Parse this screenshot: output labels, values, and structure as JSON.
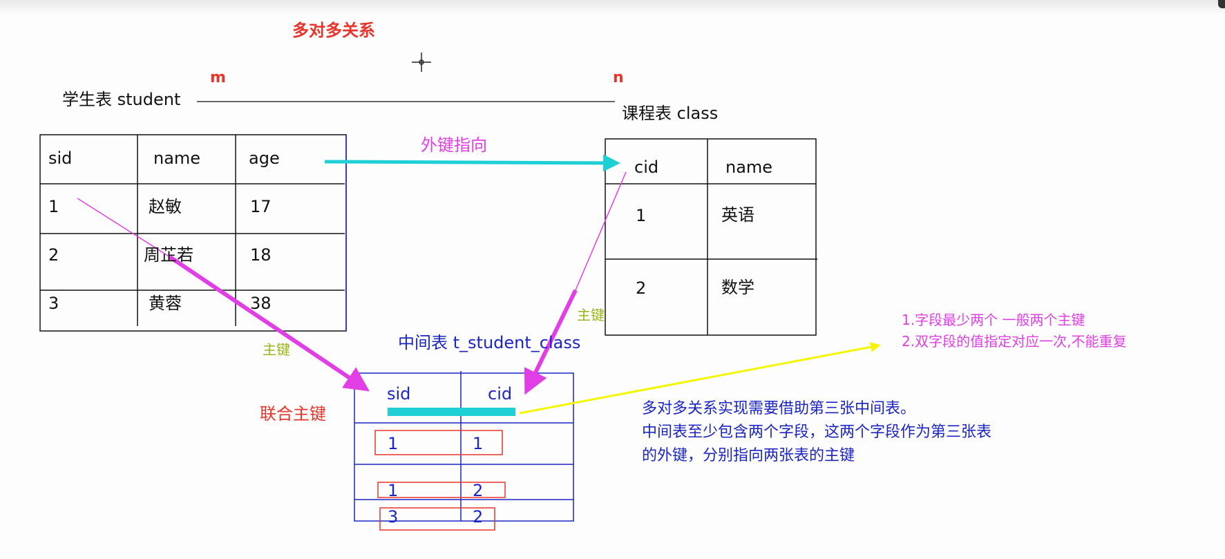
{
  "title": "多对多关系",
  "relation": {
    "m": "m",
    "n": "n"
  },
  "student_table": {
    "label": "学生表  student",
    "columns": [
      "sid",
      "name",
      "age"
    ],
    "rows": [
      [
        "1",
        "赵敏",
        "17"
      ],
      [
        "2",
        "周芷若",
        "18"
      ],
      [
        "3",
        "黄蓉",
        "38"
      ]
    ]
  },
  "class_table": {
    "label": "课程表    class",
    "columns": [
      "cid",
      "name"
    ],
    "rows": [
      [
        "1",
        "英语"
      ],
      [
        "2",
        "数学"
      ]
    ]
  },
  "middle_table": {
    "label": "中间表  t_student_class",
    "columns": [
      "sid",
      "cid"
    ],
    "rows": [
      [
        "1",
        "1"
      ],
      [
        "1",
        "2"
      ],
      [
        "3",
        "2"
      ]
    ]
  },
  "annotations": {
    "fk_pointing": "外键指向",
    "pk_left": "主键",
    "pk_right": "主键",
    "composite_pk": "联合主键",
    "note1": "1.字段最少两个 一般两个主键",
    "note2": "2.双字段的值指定对应一次,不能重复",
    "explain1": "多对多关系实现需要借助第三张中间表。",
    "explain2": "中间表至少包含两个字段，这两个字段作为第三张表",
    "explain3": "的外键，分别指向两张表的主键"
  },
  "colors": {
    "red": "#e8342a",
    "magenta": "#e13ee6",
    "cyan": "#1fcfd6",
    "yellow": "#f5f500",
    "blue": "#1b25c4",
    "green": "#9ab51a"
  }
}
